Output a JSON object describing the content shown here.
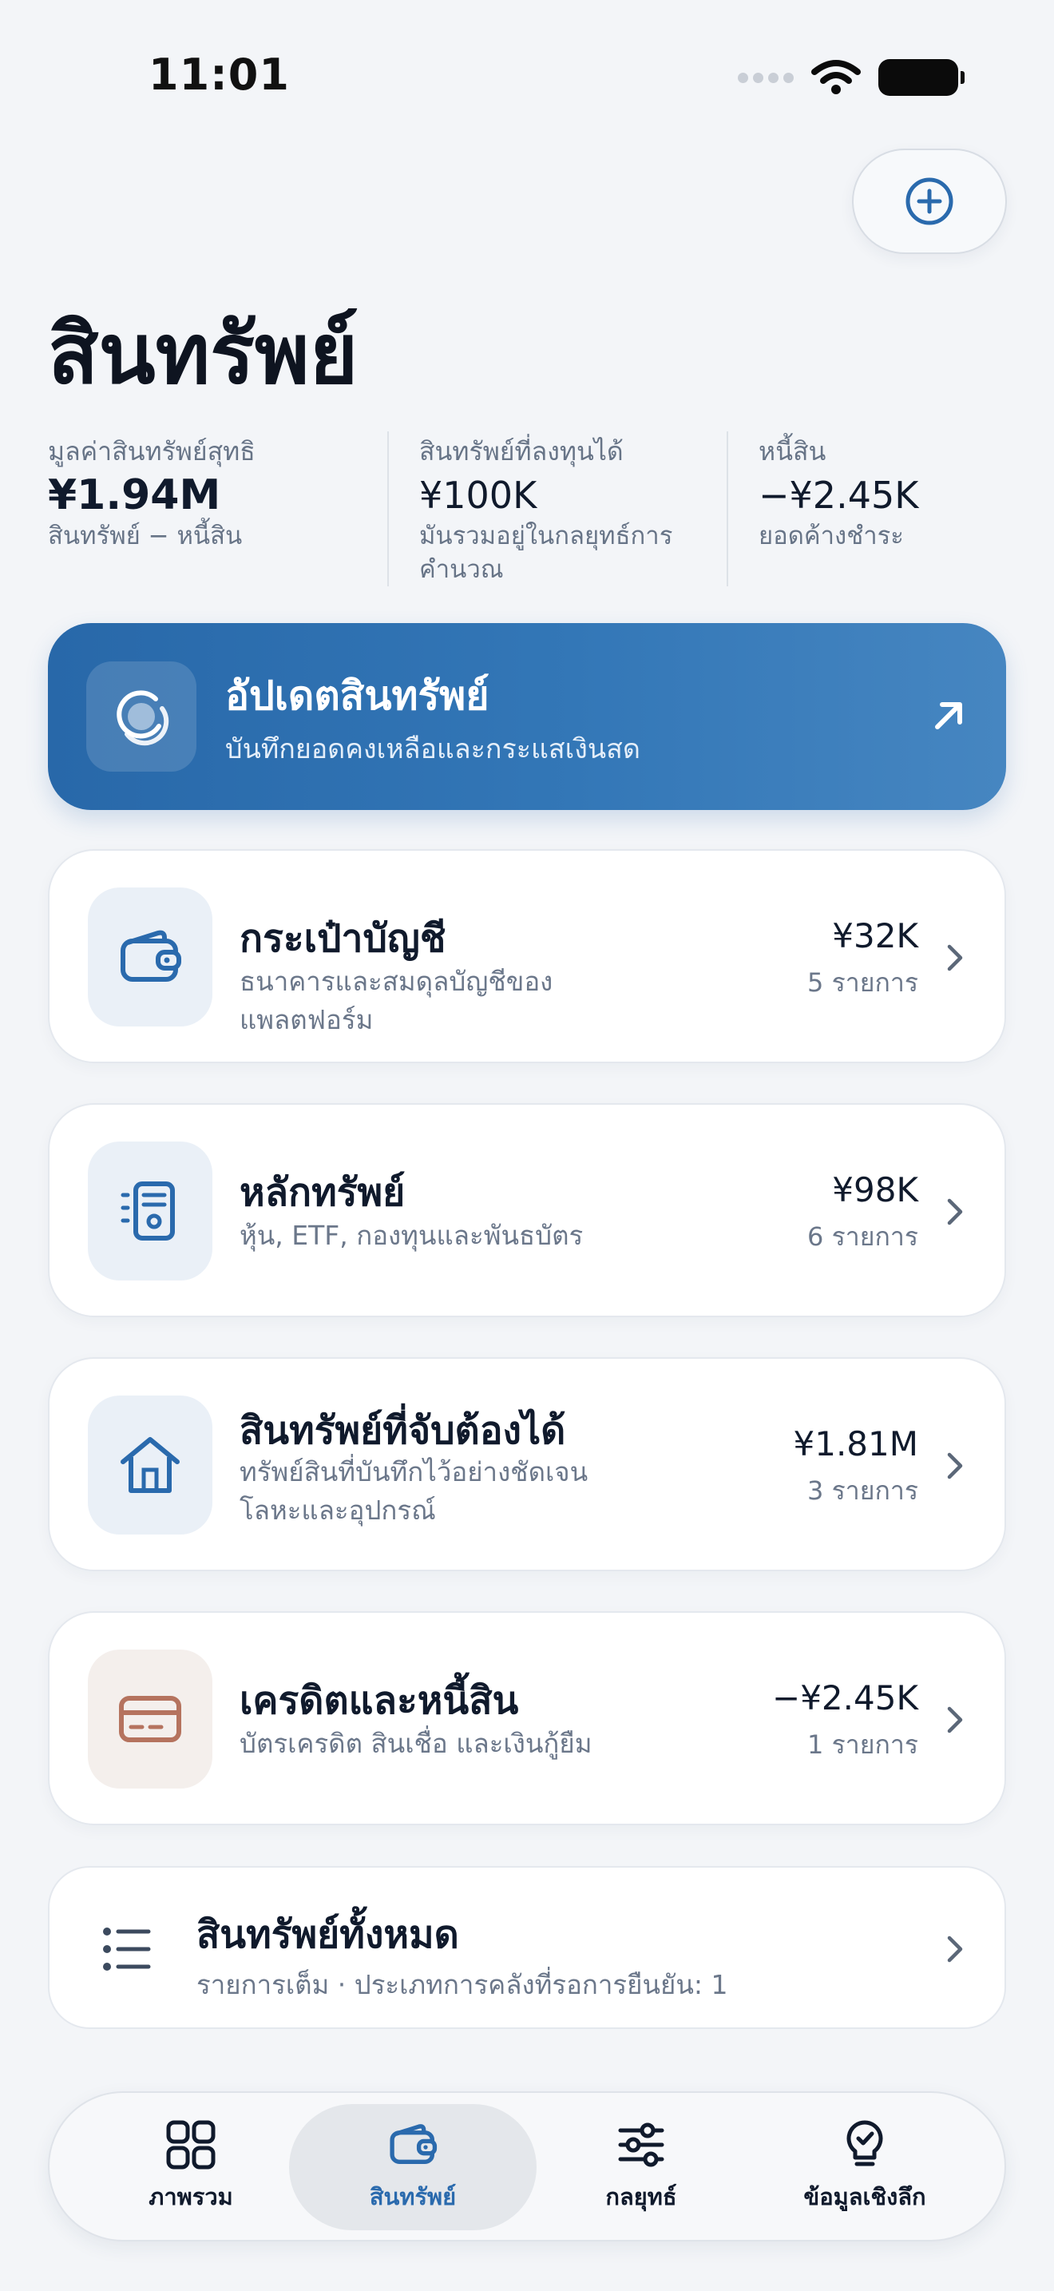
{
  "status_bar": {
    "time": "11:01"
  },
  "page_title": "สินทรัพย์",
  "summary": [
    {
      "label": "มูลค่าสินทรัพย์สุทธิ",
      "value": "¥1.94M",
      "sub": "สินทรัพย์ − หนี้สิน"
    },
    {
      "label": "สินทรัพย์ที่ลงทุนได้",
      "value": "¥100K",
      "sub": "มันรวมอยู่ในกลยุทธ์การคำนวณ"
    },
    {
      "label": "หนี้สิน",
      "value": "−¥2.45K",
      "sub": "ยอดค้างชำระ"
    }
  ],
  "banner": {
    "title": "อัปเดตสินทรัพย์",
    "subtitle": "บันทึกยอดคงเหลือและกระแสเงินสด"
  },
  "cards": [
    {
      "title": "กระเป๋าบัญชี",
      "subtitle": "ธนาคารและสมดุลบัญชีของแพลตฟอร์ม",
      "amount": "¥32K",
      "count": "5 รายการ",
      "icon": "wallet-icon"
    },
    {
      "title": "หลักทรัพย์",
      "subtitle": "หุ้น, ETF, กองทุนและพันธบัตร",
      "amount": "¥98K",
      "count": "6 รายการ",
      "icon": "document-icon"
    },
    {
      "title": "สินทรัพย์ที่จับต้องได้",
      "subtitle": "ทรัพย์สินที่บันทึกไว้อย่างชัดเจน โลหะและอุปกรณ์",
      "amount": "¥1.81M",
      "count": "3 รายการ",
      "icon": "house-icon"
    },
    {
      "title": "เครดิตและหนี้สิน",
      "subtitle": "บัตรเครดิต สินเชื่อ และเงินกู้ยืม",
      "amount": "−¥2.45K",
      "count": "1 รายการ",
      "icon": "credit-card-icon"
    }
  ],
  "all_assets": {
    "title": "สินทรัพย์ทั้งหมด",
    "subtitle": "รายการเต็ม · ประเภทการคลังที่รอการยืนยัน: 1"
  },
  "tabbar": [
    {
      "label": "ภาพรวม",
      "icon": "grid-icon",
      "active": false
    },
    {
      "label": "สินทรัพย์",
      "icon": "wallet-icon",
      "active": true
    },
    {
      "label": "กลยุทธ์",
      "icon": "sliders-icon",
      "active": false
    },
    {
      "label": "ข้อมูลเชิงลึก",
      "icon": "lightbulb-icon",
      "active": false
    }
  ],
  "colors": {
    "accent": "#2a6aad",
    "banner": "#2f70b1",
    "debt_icon": "#b5735e",
    "background": "#f3f5f8"
  }
}
